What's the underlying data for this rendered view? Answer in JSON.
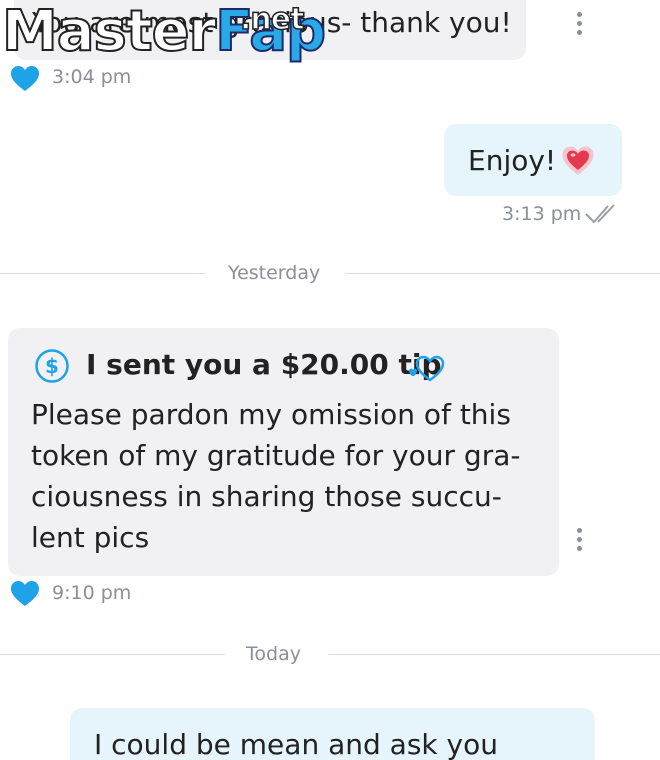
{
  "messages": {
    "m1": {
      "text": "You are most gracious- thank you!",
      "time": "3:04 pm"
    },
    "m2": {
      "text": "Enjoy!",
      "time": "3:13 pm"
    },
    "m3": {
      "tip": "I sent you a $20.00 tip",
      "lines": [
        "Please pardon my omission of this",
        "token of my gratitude for your gra-",
        "ciousness in sharing those succu-",
        "lent pics"
      ],
      "time": "9:10 pm"
    },
    "m4": {
      "text": "I could be mean and ask you"
    }
  },
  "dividers": {
    "yesterday": "Yesterday",
    "today": "Today"
  },
  "watermark": {
    "main": "Master",
    "accent": "Fap",
    "suffix": ".net"
  },
  "colors": {
    "accent": "#1fa3e8",
    "incoming_bg": "#f1f1f4",
    "outgoing_bg": "#e6f5fc",
    "muted": "#8a8f98"
  },
  "icons": {
    "like": "heart-icon",
    "menu": "kebab-menu-icon",
    "read": "double-check-icon",
    "emoji": "heart-emoji-icon",
    "tip": "dollar-circle-icon",
    "tip_heart": "outline-heart-icon"
  }
}
